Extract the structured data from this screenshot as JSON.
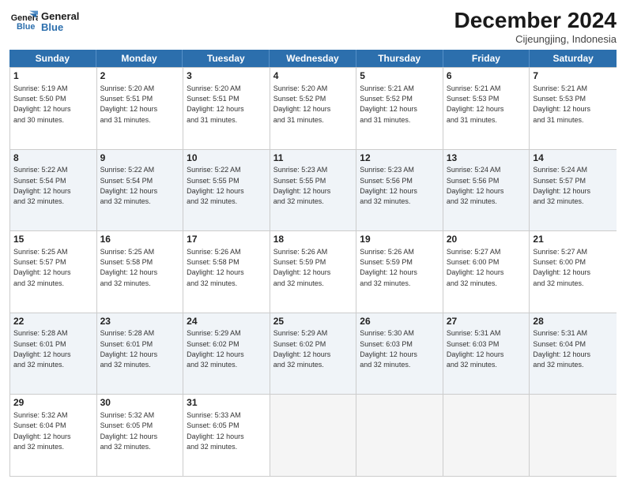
{
  "logo": {
    "line1": "General",
    "line2": "Blue"
  },
  "title": "December 2024",
  "location": "Cijeungjing, Indonesia",
  "header_days": [
    "Sunday",
    "Monday",
    "Tuesday",
    "Wednesday",
    "Thursday",
    "Friday",
    "Saturday"
  ],
  "weeks": [
    {
      "shaded": false,
      "cells": [
        {
          "day": "1",
          "info": "Sunrise: 5:19 AM\nSunset: 5:50 PM\nDaylight: 12 hours\nand 30 minutes."
        },
        {
          "day": "2",
          "info": "Sunrise: 5:20 AM\nSunset: 5:51 PM\nDaylight: 12 hours\nand 31 minutes."
        },
        {
          "day": "3",
          "info": "Sunrise: 5:20 AM\nSunset: 5:51 PM\nDaylight: 12 hours\nand 31 minutes."
        },
        {
          "day": "4",
          "info": "Sunrise: 5:20 AM\nSunset: 5:52 PM\nDaylight: 12 hours\nand 31 minutes."
        },
        {
          "day": "5",
          "info": "Sunrise: 5:21 AM\nSunset: 5:52 PM\nDaylight: 12 hours\nand 31 minutes."
        },
        {
          "day": "6",
          "info": "Sunrise: 5:21 AM\nSunset: 5:53 PM\nDaylight: 12 hours\nand 31 minutes."
        },
        {
          "day": "7",
          "info": "Sunrise: 5:21 AM\nSunset: 5:53 PM\nDaylight: 12 hours\nand 31 minutes."
        }
      ]
    },
    {
      "shaded": true,
      "cells": [
        {
          "day": "8",
          "info": "Sunrise: 5:22 AM\nSunset: 5:54 PM\nDaylight: 12 hours\nand 32 minutes."
        },
        {
          "day": "9",
          "info": "Sunrise: 5:22 AM\nSunset: 5:54 PM\nDaylight: 12 hours\nand 32 minutes."
        },
        {
          "day": "10",
          "info": "Sunrise: 5:22 AM\nSunset: 5:55 PM\nDaylight: 12 hours\nand 32 minutes."
        },
        {
          "day": "11",
          "info": "Sunrise: 5:23 AM\nSunset: 5:55 PM\nDaylight: 12 hours\nand 32 minutes."
        },
        {
          "day": "12",
          "info": "Sunrise: 5:23 AM\nSunset: 5:56 PM\nDaylight: 12 hours\nand 32 minutes."
        },
        {
          "day": "13",
          "info": "Sunrise: 5:24 AM\nSunset: 5:56 PM\nDaylight: 12 hours\nand 32 minutes."
        },
        {
          "day": "14",
          "info": "Sunrise: 5:24 AM\nSunset: 5:57 PM\nDaylight: 12 hours\nand 32 minutes."
        }
      ]
    },
    {
      "shaded": false,
      "cells": [
        {
          "day": "15",
          "info": "Sunrise: 5:25 AM\nSunset: 5:57 PM\nDaylight: 12 hours\nand 32 minutes."
        },
        {
          "day": "16",
          "info": "Sunrise: 5:25 AM\nSunset: 5:58 PM\nDaylight: 12 hours\nand 32 minutes."
        },
        {
          "day": "17",
          "info": "Sunrise: 5:26 AM\nSunset: 5:58 PM\nDaylight: 12 hours\nand 32 minutes."
        },
        {
          "day": "18",
          "info": "Sunrise: 5:26 AM\nSunset: 5:59 PM\nDaylight: 12 hours\nand 32 minutes."
        },
        {
          "day": "19",
          "info": "Sunrise: 5:26 AM\nSunset: 5:59 PM\nDaylight: 12 hours\nand 32 minutes."
        },
        {
          "day": "20",
          "info": "Sunrise: 5:27 AM\nSunset: 6:00 PM\nDaylight: 12 hours\nand 32 minutes."
        },
        {
          "day": "21",
          "info": "Sunrise: 5:27 AM\nSunset: 6:00 PM\nDaylight: 12 hours\nand 32 minutes."
        }
      ]
    },
    {
      "shaded": true,
      "cells": [
        {
          "day": "22",
          "info": "Sunrise: 5:28 AM\nSunset: 6:01 PM\nDaylight: 12 hours\nand 32 minutes."
        },
        {
          "day": "23",
          "info": "Sunrise: 5:28 AM\nSunset: 6:01 PM\nDaylight: 12 hours\nand 32 minutes."
        },
        {
          "day": "24",
          "info": "Sunrise: 5:29 AM\nSunset: 6:02 PM\nDaylight: 12 hours\nand 32 minutes."
        },
        {
          "day": "25",
          "info": "Sunrise: 5:29 AM\nSunset: 6:02 PM\nDaylight: 12 hours\nand 32 minutes."
        },
        {
          "day": "26",
          "info": "Sunrise: 5:30 AM\nSunset: 6:03 PM\nDaylight: 12 hours\nand 32 minutes."
        },
        {
          "day": "27",
          "info": "Sunrise: 5:31 AM\nSunset: 6:03 PM\nDaylight: 12 hours\nand 32 minutes."
        },
        {
          "day": "28",
          "info": "Sunrise: 5:31 AM\nSunset: 6:04 PM\nDaylight: 12 hours\nand 32 minutes."
        }
      ]
    },
    {
      "shaded": false,
      "cells": [
        {
          "day": "29",
          "info": "Sunrise: 5:32 AM\nSunset: 6:04 PM\nDaylight: 12 hours\nand 32 minutes."
        },
        {
          "day": "30",
          "info": "Sunrise: 5:32 AM\nSunset: 6:05 PM\nDaylight: 12 hours\nand 32 minutes."
        },
        {
          "day": "31",
          "info": "Sunrise: 5:33 AM\nSunset: 6:05 PM\nDaylight: 12 hours\nand 32 minutes."
        },
        {
          "day": "",
          "info": ""
        },
        {
          "day": "",
          "info": ""
        },
        {
          "day": "",
          "info": ""
        },
        {
          "day": "",
          "info": ""
        }
      ]
    }
  ]
}
